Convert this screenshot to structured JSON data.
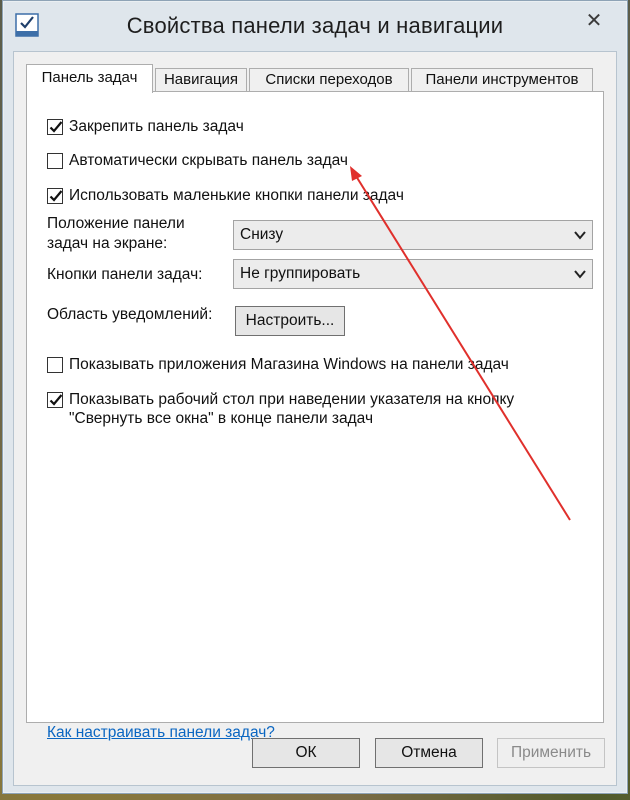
{
  "window": {
    "title": "Свойства панели задач и навигации",
    "close_symbol": "✕"
  },
  "tabs": [
    {
      "label": "Панель задач",
      "active": true
    },
    {
      "label": "Навигация",
      "active": false
    },
    {
      "label": "Списки переходов",
      "active": false
    },
    {
      "label": "Панели инструментов",
      "active": false
    }
  ],
  "checkboxes": {
    "lock_taskbar": {
      "label": "Закрепить панель задач",
      "checked": true
    },
    "autohide": {
      "label": "Автоматически скрывать панель задач",
      "checked": false
    },
    "small_buttons": {
      "label": "Использовать маленькие кнопки панели задач",
      "checked": true
    },
    "store_apps": {
      "label": "Показывать приложения Магазина Windows на панели задач",
      "checked": false
    },
    "peek_line1": "Показывать рабочий стол при наведении указателя на кнопку",
    "peek_line2": "\"Свернуть все окна\" в конце панели задач",
    "peek_checked": true
  },
  "position": {
    "label_line1": "Положение панели",
    "label_line2": "задач на экране:",
    "value": "Снизу"
  },
  "buttons_group": {
    "label": "Кнопки панели задач:",
    "value": "Не группировать"
  },
  "notifications": {
    "label": "Область уведомлений:",
    "button": "Настроить..."
  },
  "help_link": "Как настраивать панели задач?",
  "footer": {
    "ok": "ОК",
    "cancel": "Отмена",
    "apply": "Применить"
  },
  "icons": {
    "title": "taskbar-properties-icon",
    "checkmark": "check-icon",
    "dropdown": "chevron-down-icon"
  },
  "colors": {
    "window_frame": "#dfe6ec",
    "link": "#0a66c2",
    "annotation_arrow": "#e0302c"
  }
}
